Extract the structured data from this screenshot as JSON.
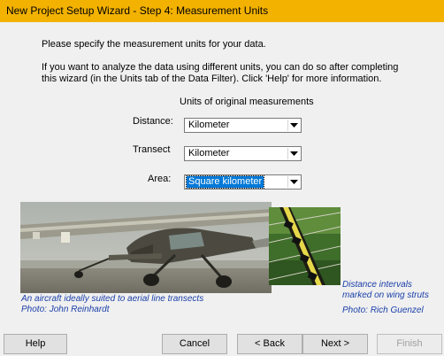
{
  "window": {
    "title": "New Project Setup Wizard - Step 4: Measurement Units"
  },
  "intro": {
    "line1": "Please specify the measurement units for your data.",
    "line2": "If you want to analyze the data using different units, you can do so after completing",
    "line3": "this wizard (in the Units tab of the Data Filter).  Click 'Help' for more information."
  },
  "units": {
    "heading": "Units of original measurements",
    "distance_label": "Distance:",
    "distance_value": "Kilometer",
    "transect_label": "Transect",
    "transect_value": "Kilometer",
    "area_label": "Area:",
    "area_value": "Square kilometer"
  },
  "captions": {
    "left_line1": "An aircraft ideally suited to aerial line transects",
    "left_line2": "Photo: John Reinhardt",
    "right_line1": "Distance intervals",
    "right_line2": "marked on wing struts",
    "right_line3": "Photo: Rich Guenzel"
  },
  "buttons": {
    "help": "Help",
    "cancel": "Cancel",
    "back": "< Back",
    "next": "Next >",
    "finish": "Finish"
  },
  "icons": [
    "dropdown-arrow-icon"
  ],
  "colors": {
    "titlebar": "#f3b200",
    "caption": "#1a3fa8",
    "selection": "#0078d7"
  }
}
